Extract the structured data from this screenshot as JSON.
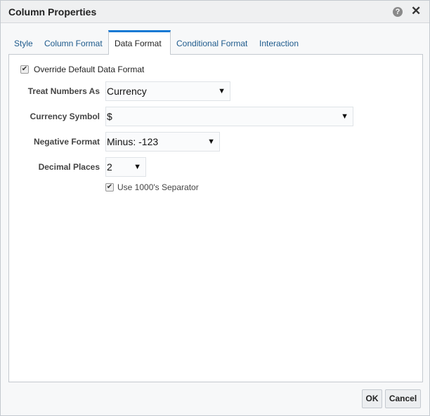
{
  "dialog": {
    "title": "Column Properties",
    "help_icon": "?",
    "close_icon": "✕"
  },
  "tabs": [
    {
      "label": "Style"
    },
    {
      "label": "Column Format"
    },
    {
      "label": "Data Format",
      "active": true
    },
    {
      "label": "Conditional Format"
    },
    {
      "label": "Interaction"
    }
  ],
  "override": {
    "label": "Override Default Data Format",
    "checked": true
  },
  "fields": {
    "treat": {
      "label": "Treat Numbers As",
      "value": "Currency"
    },
    "currency": {
      "label": "Currency Symbol",
      "value": "$"
    },
    "negative": {
      "label": "Negative Format",
      "value": "Minus: -123"
    },
    "decimal": {
      "label": "Decimal Places",
      "value": "2"
    }
  },
  "separator": {
    "label": "Use 1000's Separator",
    "checked": true
  },
  "buttons": {
    "ok": "OK",
    "cancel": "Cancel"
  }
}
